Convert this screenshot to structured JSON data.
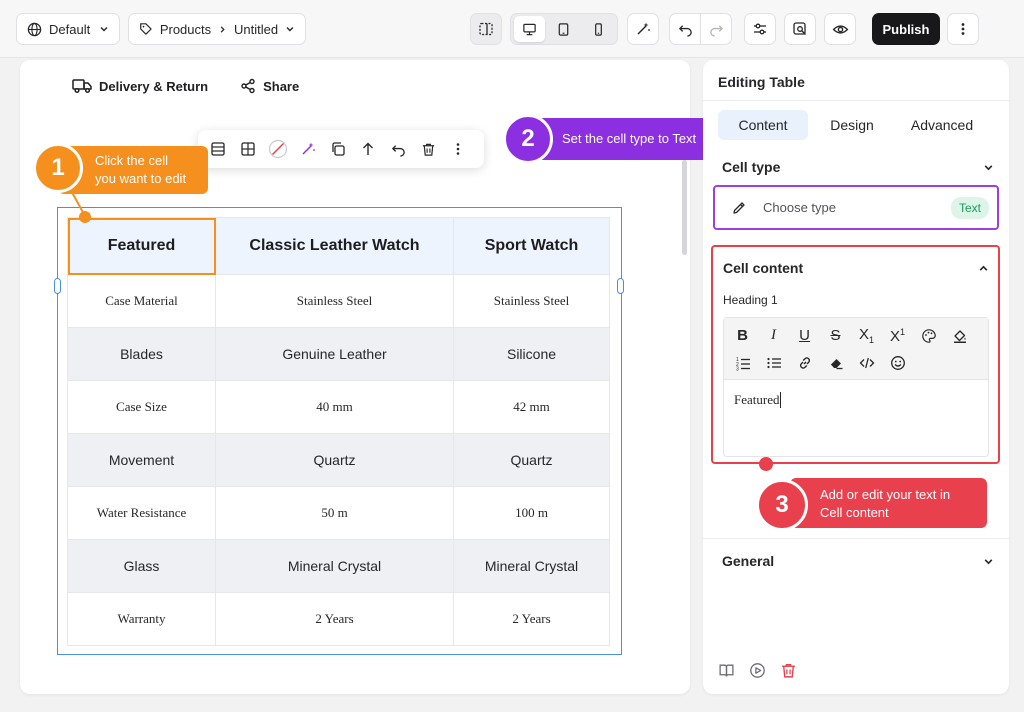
{
  "topbar": {
    "site_selector": "Default",
    "breadcrumb_section": "Products",
    "breadcrumb_page": "Untitled",
    "publish_label": "Publish"
  },
  "canvas": {
    "links": [
      "Delivery & Return",
      "Share"
    ],
    "table": {
      "headers": [
        "Featured",
        "Classic Leather Watch",
        "Sport Watch"
      ],
      "rows": [
        {
          "style": "serif",
          "cells": [
            "Case Material",
            "Stainless Steel",
            "Stainless Steel"
          ]
        },
        {
          "style": "sans",
          "cells": [
            "Blades",
            "Genuine Leather",
            "Silicone"
          ]
        },
        {
          "style": "serif",
          "cells": [
            "Case Size",
            "40 mm",
            "42 mm"
          ]
        },
        {
          "style": "sans",
          "cells": [
            "Movement",
            "Quartz",
            "Quartz"
          ]
        },
        {
          "style": "serif",
          "cells": [
            "Water Resistance",
            "50 m",
            "100 m"
          ]
        },
        {
          "style": "sans",
          "cells": [
            "Glass",
            "Mineral Crystal",
            "Mineral Crystal"
          ]
        },
        {
          "style": "serif",
          "cells": [
            "Warranty",
            "2 Years",
            "2 Years"
          ]
        }
      ]
    }
  },
  "callouts": [
    {
      "number": "1",
      "text_line1": "Click the cell",
      "text_line2": "you want to edit",
      "color": "#f5901e"
    },
    {
      "number": "2",
      "text_line1": "Set the cell type to Text",
      "text_line2": "",
      "color": "#8b2fe0"
    },
    {
      "number": "3",
      "text_line1": "Add or edit your text in",
      "text_line2": "Cell content",
      "color": "#e8414d"
    }
  ],
  "panel": {
    "title": "Editing Table",
    "tabs": [
      {
        "label": "Content",
        "active": true
      },
      {
        "label": "Design",
        "active": false
      },
      {
        "label": "Advanced",
        "active": false
      }
    ],
    "cell_type": {
      "label": "Cell type",
      "placeholder": "Choose type",
      "selected_tag": "Text"
    },
    "cell_content": {
      "label": "Cell content",
      "heading_level": "Heading 1",
      "editor_text": "Featured"
    },
    "general_label": "General"
  },
  "colors": {
    "accent_blue": "#4a8fe7",
    "selection_orange": "#f5901e",
    "step2_purple": "#8b2fe0",
    "step3_red": "#e8414d",
    "tag_green": "#1c9a5b"
  }
}
